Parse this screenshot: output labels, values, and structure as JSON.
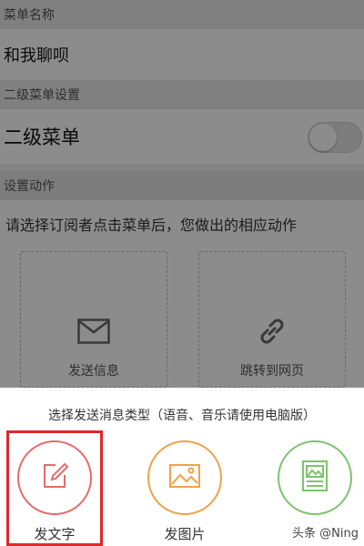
{
  "form": {
    "menu_name_header": "菜单名称",
    "menu_name_value": "和我聊呗",
    "submenu_header": "二级菜单设置",
    "submenu_label": "二级菜单",
    "action_header": "设置动作",
    "action_prompt": "请选择订阅者点击菜单后，您做出的相应动作",
    "actions": [
      {
        "label": "发送信息",
        "icon": "mail-icon"
      },
      {
        "label": "跳转到网页",
        "icon": "link-icon"
      }
    ]
  },
  "sheet": {
    "title": "选择发送消息类型（语音、音乐请使用电脑版）",
    "options": [
      {
        "label": "发文字",
        "icon": "edit-icon",
        "color": "#e86a6a",
        "selected": true
      },
      {
        "label": "发图片",
        "icon": "image-icon",
        "color": "#f0a24a"
      },
      {
        "label": "",
        "icon": "article-icon",
        "color": "#7cc46c"
      }
    ]
  },
  "watermark": "头条 @Ning"
}
